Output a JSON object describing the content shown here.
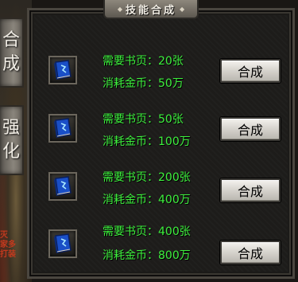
{
  "window": {
    "title": "技能合成"
  },
  "tabs": [
    {
      "label_top": "合",
      "label_bottom": "成"
    },
    {
      "label_top": "强",
      "label_bottom": "化"
    }
  ],
  "background_text": {
    "line1": "灭",
    "line2": "家多",
    "line3": "打装"
  },
  "recipes": [
    {
      "pages_label": "需要书页：",
      "pages_value": "20张",
      "gold_label": "消耗金币：",
      "gold_value": "50万",
      "button": "合成"
    },
    {
      "pages_label": "需要书页：",
      "pages_value": "50张",
      "gold_label": "消耗金币：",
      "gold_value": "100万",
      "button": "合成"
    },
    {
      "pages_label": "需要书页：",
      "pages_value": "200张",
      "gold_label": "消耗金币：",
      "gold_value": "400万",
      "button": "合成"
    },
    {
      "pages_label": "需要书页：",
      "pages_value": "400张",
      "gold_label": "消耗金币：",
      "gold_value": "800万",
      "button": "合成"
    }
  ],
  "colors": {
    "text_green": "#3df03d",
    "panel_bg": "#1d1c1a",
    "button_bg": "#e6e3de"
  },
  "icons": {
    "item": "skill-book-icon"
  }
}
